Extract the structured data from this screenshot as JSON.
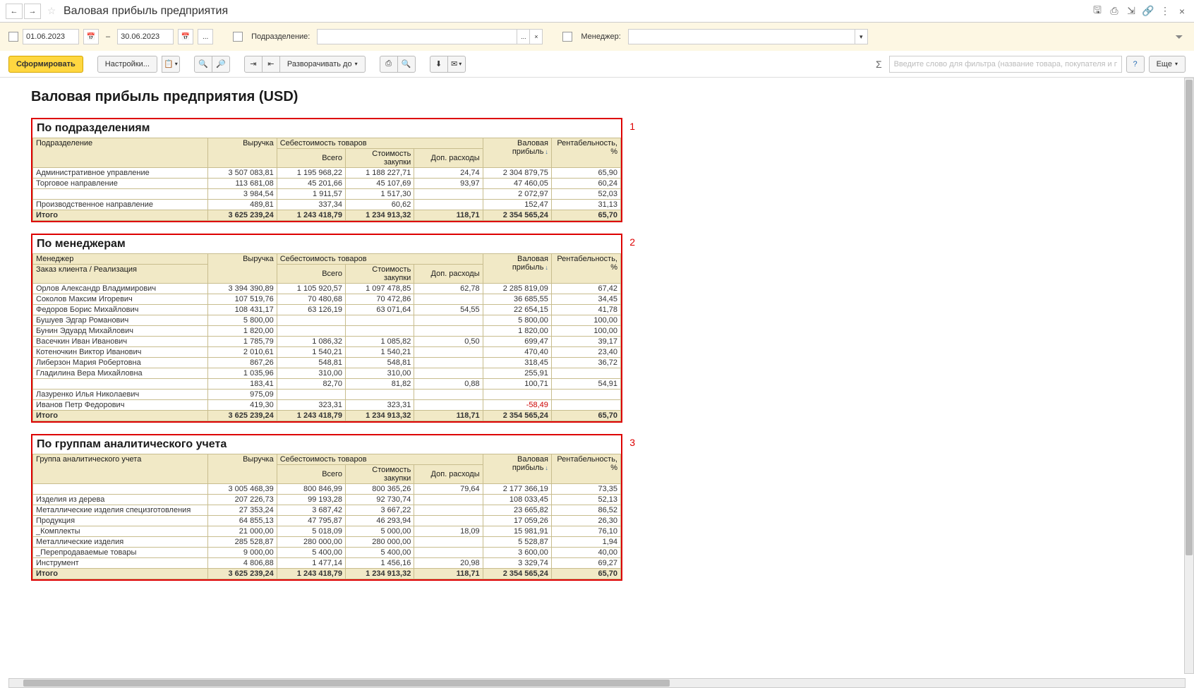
{
  "titleBar": {
    "title": "Валовая прибыль предприятия"
  },
  "filterBar": {
    "dateFrom": "01.06.2023",
    "dateTo": "30.06.2023",
    "dash": "–",
    "ellipsis": "...",
    "departmentLabel": "Подразделение:",
    "managerLabel": "Менеджер:"
  },
  "toolbar": {
    "generate": "Сформировать",
    "settings": "Настройки...",
    "unfold": "Разворачивать до",
    "sigma": "Σ",
    "searchPlaceholder": "Введите слово для фильтра (название товара, покупателя и пр.)",
    "help": "?",
    "more": "Еще"
  },
  "report": {
    "title": "Валовая прибыль предприятия (USD)",
    "columns": {
      "revenue": "Выручка",
      "costGroup": "Себестоимость товаров",
      "costTotal": "Всего",
      "costPurchase": "Стоимость закупки",
      "costExtra": "Доп. расходы",
      "gross": "Валовая прибыль",
      "profit": "Рентабельность, %",
      "totalLabel": "Итого"
    },
    "annotations": {
      "s1": "1",
      "s2": "2",
      "s3": "3"
    },
    "section1": {
      "title": "По подразделениям",
      "rowHeader": "Подразделение",
      "rows": [
        {
          "name": "Административное управление",
          "rev": "3 507 083,81",
          "ct": "1 195 968,22",
          "cp": "1 188 227,71",
          "ce": "24,74",
          "gp": "2 304 879,75",
          "pr": "65,90"
        },
        {
          "name": "Торговое направление",
          "rev": "113 681,08",
          "ct": "45 201,66",
          "cp": "45 107,69",
          "ce": "93,97",
          "gp": "47 460,05",
          "pr": "60,24"
        },
        {
          "name": "",
          "rev": "3 984,54",
          "ct": "1 911,57",
          "cp": "1 517,30",
          "ce": "",
          "gp": "2 072,97",
          "pr": "52,03"
        },
        {
          "name": "Производственное направление",
          "rev": "489,81",
          "ct": "337,34",
          "cp": "60,62",
          "ce": "",
          "gp": "152,47",
          "pr": "31,13"
        }
      ],
      "total": {
        "rev": "3 625 239,24",
        "ct": "1 243 418,79",
        "cp": "1 234 913,32",
        "ce": "118,71",
        "gp": "2 354 565,24",
        "pr": "65,70"
      }
    },
    "section2": {
      "title": "По менеджерам",
      "rowHeader1": "Менеджер",
      "rowHeader2": "Заказ клиента / Реализация",
      "rows": [
        {
          "name": "Орлов Александр Владимирович",
          "rev": "3 394 390,89",
          "ct": "1 105 920,57",
          "cp": "1 097 478,85",
          "ce": "62,78",
          "gp": "2 285 819,09",
          "pr": "67,42"
        },
        {
          "name": "Соколов Максим Игоревич",
          "rev": "107 519,76",
          "ct": "70 480,68",
          "cp": "70 472,86",
          "ce": "",
          "gp": "36 685,55",
          "pr": "34,45"
        },
        {
          "name": "Федоров Борис Михайлович",
          "rev": "108 431,17",
          "ct": "63 126,19",
          "cp": "63 071,64",
          "ce": "54,55",
          "gp": "22 654,15",
          "pr": "41,78"
        },
        {
          "name": "Бушуев Эдгар Романович",
          "rev": "5 800,00",
          "ct": "",
          "cp": "",
          "ce": "",
          "gp": "5 800,00",
          "pr": "100,00"
        },
        {
          "name": "Бунин Эдуард Михайлович",
          "rev": "1 820,00",
          "ct": "",
          "cp": "",
          "ce": "",
          "gp": "1 820,00",
          "pr": "100,00"
        },
        {
          "name": "Васечкин Иван Иванович",
          "rev": "1 785,79",
          "ct": "1 086,32",
          "cp": "1 085,82",
          "ce": "0,50",
          "gp": "699,47",
          "pr": "39,17"
        },
        {
          "name": "Котеночкин Виктор Иванович",
          "rev": "2 010,61",
          "ct": "1 540,21",
          "cp": "1 540,21",
          "ce": "",
          "gp": "470,40",
          "pr": "23,40"
        },
        {
          "name": "Либерзон Мария Робертовна",
          "rev": "867,26",
          "ct": "548,81",
          "cp": "548,81",
          "ce": "",
          "gp": "318,45",
          "pr": "36,72"
        },
        {
          "name": "Гладилина Вера Михайловна",
          "rev": "1 035,96",
          "ct": "310,00",
          "cp": "310,00",
          "ce": "",
          "gp": "255,91",
          "pr": ""
        },
        {
          "name": "",
          "rev": "183,41",
          "ct": "82,70",
          "cp": "81,82",
          "ce": "0,88",
          "gp": "100,71",
          "pr": "54,91"
        },
        {
          "name": "Лазуренко Илья Николаевич",
          "rev": "975,09",
          "ct": "",
          "cp": "",
          "ce": "",
          "gp": "",
          "pr": ""
        },
        {
          "name": "Иванов Петр Федорович",
          "rev": "419,30",
          "ct": "323,31",
          "cp": "323,31",
          "ce": "",
          "gp": "-58,49",
          "pr": "",
          "neg": true
        }
      ],
      "total": {
        "rev": "3 625 239,24",
        "ct": "1 243 418,79",
        "cp": "1 234 913,32",
        "ce": "118,71",
        "gp": "2 354 565,24",
        "pr": "65,70"
      }
    },
    "section3": {
      "title": "По группам аналитического учета",
      "rowHeader": "Группа аналитического учета",
      "rows": [
        {
          "name": "",
          "rev": "3 005 468,39",
          "ct": "800 846,99",
          "cp": "800 365,26",
          "ce": "79,64",
          "gp": "2 177 366,19",
          "pr": "73,35"
        },
        {
          "name": "Изделия из дерева",
          "rev": "207 226,73",
          "ct": "99 193,28",
          "cp": "92 730,74",
          "ce": "",
          "gp": "108 033,45",
          "pr": "52,13"
        },
        {
          "name": "Металлические изделия специзготовления",
          "rev": "27 353,24",
          "ct": "3 687,42",
          "cp": "3 667,22",
          "ce": "",
          "gp": "23 665,82",
          "pr": "86,52"
        },
        {
          "name": "Продукция",
          "rev": "64 855,13",
          "ct": "47 795,87",
          "cp": "46 293,94",
          "ce": "",
          "gp": "17 059,26",
          "pr": "26,30"
        },
        {
          "name": "_Комплекты",
          "rev": "21 000,00",
          "ct": "5 018,09",
          "cp": "5 000,00",
          "ce": "18,09",
          "gp": "15 981,91",
          "pr": "76,10"
        },
        {
          "name": "Металлические изделия",
          "rev": "285 528,87",
          "ct": "280 000,00",
          "cp": "280 000,00",
          "ce": "",
          "gp": "5 528,87",
          "pr": "1,94"
        },
        {
          "name": "_Перепродаваемые товары",
          "rev": "9 000,00",
          "ct": "5 400,00",
          "cp": "5 400,00",
          "ce": "",
          "gp": "3 600,00",
          "pr": "40,00"
        },
        {
          "name": "Инструмент",
          "rev": "4 806,88",
          "ct": "1 477,14",
          "cp": "1 456,16",
          "ce": "20,98",
          "gp": "3 329,74",
          "pr": "69,27"
        }
      ],
      "total": {
        "rev": "3 625 239,24",
        "ct": "1 243 418,79",
        "cp": "1 234 913,32",
        "ce": "118,71",
        "gp": "2 354 565,24",
        "pr": "65,70"
      }
    }
  }
}
